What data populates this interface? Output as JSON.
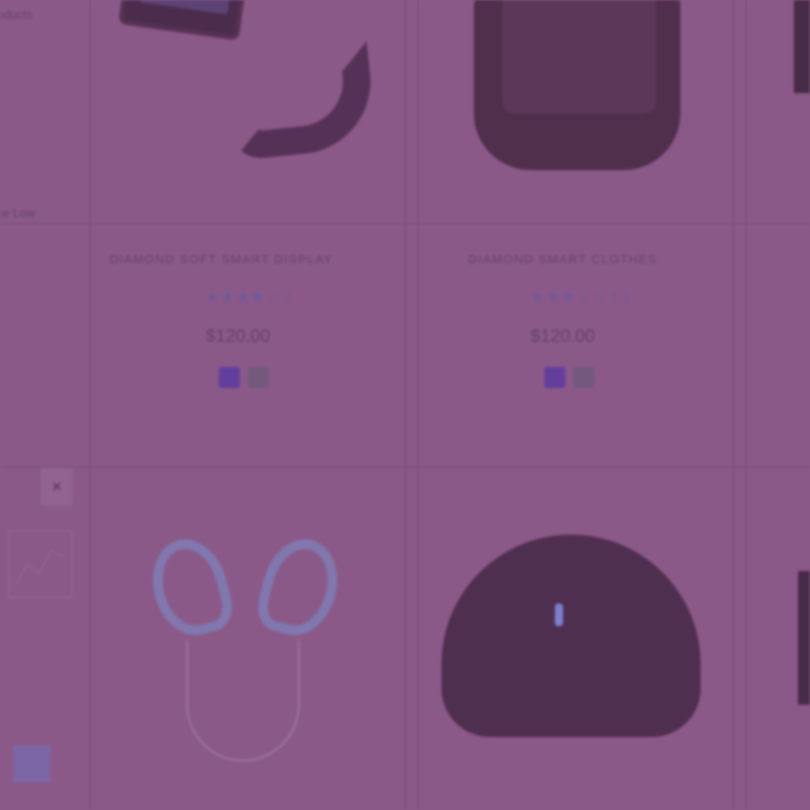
{
  "sidebar": {
    "top_text": "oducts",
    "mid_text": "ce Low",
    "close_glyph": "×"
  },
  "products": [
    {
      "title": "DIAMOND SOFT SMART DISPLAY",
      "rating": 4,
      "stars": "★★★★☆",
      "review_count": "1",
      "price": "$120.00",
      "swatches": [
        "purple",
        "gray"
      ]
    },
    {
      "title": "DIAMOND SMART CLOTHES",
      "rating": 3,
      "stars": "★★★☆☆",
      "review_count": "1 2",
      "price": "$120.00",
      "swatches": [
        "purple",
        "gray"
      ]
    }
  ],
  "colors": {
    "page_tint": "#8b5a88",
    "star_color": "#6a5aa0",
    "swatch_purple": "#5a3aa0",
    "swatch_gray": "#6e5a78"
  },
  "icons": {
    "close": "close-icon",
    "star": "star-icon",
    "chart": "chart-icon"
  }
}
